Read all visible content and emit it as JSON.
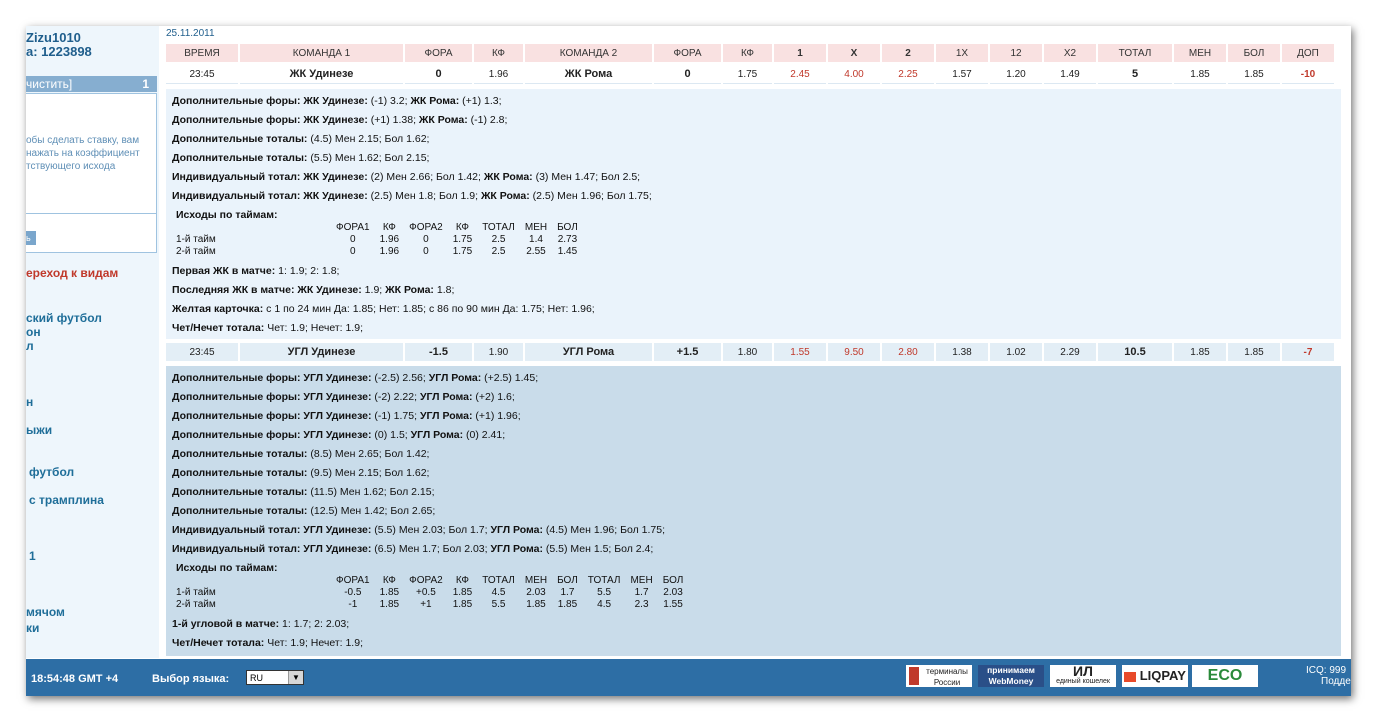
{
  "sidebar": {
    "username": "Zizu1010",
    "account": "а: 1223898",
    "clear_label": "чистить]",
    "bet_count": "1",
    "hint_lines": [
      "обы сделать ставку, вам",
      "нажать на коэффициент",
      "тствующего исхода"
    ],
    "small_button": "ь",
    "nav_red": "ереход к видам",
    "nav_items": [
      "ский футбол",
      "он",
      "л",
      "",
      "ыжи",
      "футбол",
      "с трамплина",
      "1",
      "мячом",
      "ки"
    ]
  },
  "date": "25.11.2011",
  "headers": [
    "ВРЕМЯ",
    "КОМАНДА 1",
    "ФОРА",
    "КФ",
    "КОМАНДА 2",
    "ФОРА",
    "КФ",
    "1",
    "X",
    "2",
    "1X",
    "12",
    "X2",
    "ТОТАЛ",
    "МЕН",
    "БОЛ",
    "ДОП"
  ],
  "match1": {
    "row": [
      "23:45",
      "ЖК Удинезе",
      "0",
      "1.96",
      "ЖК Рома",
      "0",
      "1.75",
      "2.45",
      "4.00",
      "2.25",
      "1.57",
      "1.20",
      "1.49",
      "5",
      "1.85",
      "1.85",
      "-10"
    ],
    "lines": [
      [
        [
          "b",
          "Дополнительные форы: ЖК Удинезе:"
        ],
        [
          "t",
          " (-1) 3.2; "
        ],
        [
          "b",
          "ЖК Рома:"
        ],
        [
          "t",
          " (+1) 1.3;"
        ]
      ],
      [
        [
          "b",
          "Дополнительные форы: ЖК Удинезе:"
        ],
        [
          "t",
          " (+1) 1.38; "
        ],
        [
          "b",
          "ЖК Рома:"
        ],
        [
          "t",
          " (-1) 2.8;"
        ]
      ],
      [
        [
          "b",
          "Дополнительные тоталы:"
        ],
        [
          "t",
          " (4.5) Мен 2.15; Бол 1.62;"
        ]
      ],
      [
        [
          "b",
          "Дополнительные тоталы:"
        ],
        [
          "t",
          " (5.5) Мен 1.62; Бол 2.15;"
        ]
      ],
      [
        [
          "b",
          "Индивидуальный тотал: ЖК Удинезе:"
        ],
        [
          "t",
          " (2) Мен 2.66; Бол 1.42; "
        ],
        [
          "b",
          "ЖК Рома:"
        ],
        [
          "t",
          " (3) Мен 1.47; Бол 2.5;"
        ]
      ],
      [
        [
          "b",
          "Индивидуальный тотал: ЖК Удинезе:"
        ],
        [
          "t",
          " (2.5) Мен 1.8; Бол 1.9; "
        ],
        [
          "b",
          "ЖК Рома:"
        ],
        [
          "t",
          " (2.5) Мен 1.96; Бол 1.75;"
        ]
      ]
    ],
    "periods_title": "Исходы по таймам:",
    "periods_headers": [
      "",
      "ФОРА1",
      "КФ",
      "ФОРА2",
      "КФ",
      "ТОТАЛ",
      "МЕН",
      "БОЛ"
    ],
    "periods_rows": [
      [
        "1-й тайм",
        "0",
        "1.96",
        "0",
        "1.75",
        "2.5",
        "1.4",
        "2.73"
      ],
      [
        "2-й тайм",
        "0",
        "1.96",
        "0",
        "1.75",
        "2.5",
        "2.55",
        "1.45"
      ]
    ],
    "lines_after": [
      [
        [
          "b",
          "Первая ЖК в матче:"
        ],
        [
          "t",
          " 1: 1.9; 2: 1.8;"
        ]
      ],
      [
        [
          "b",
          "Последняя ЖК в матче: ЖК Удинезе:"
        ],
        [
          "t",
          " 1.9; "
        ],
        [
          "b",
          "ЖК Рома:"
        ],
        [
          "t",
          " 1.8;"
        ]
      ],
      [
        [
          "b",
          "Желтая карточка:"
        ],
        [
          "t",
          " с 1 по 24 мин Да: 1.85; Нет: 1.85; с 86 по 90 мин Да: 1.75; Нет: 1.96;"
        ]
      ],
      [
        [
          "b",
          "Чет/Нечет тотала:"
        ],
        [
          "t",
          " Чет: 1.9; Нечет: 1.9;"
        ]
      ]
    ]
  },
  "match2": {
    "row": [
      "23:45",
      "УГЛ Удинезе",
      "-1.5",
      "1.90",
      "УГЛ Рома",
      "+1.5",
      "1.80",
      "1.55",
      "9.50",
      "2.80",
      "1.38",
      "1.02",
      "2.29",
      "10.5",
      "1.85",
      "1.85",
      "-7"
    ],
    "lines": [
      [
        [
          "b",
          "Дополнительные форы: УГЛ Удинезе:"
        ],
        [
          "t",
          " (-2.5) 2.56; "
        ],
        [
          "b",
          "УГЛ Рома:"
        ],
        [
          "t",
          " (+2.5) 1.45;"
        ]
      ],
      [
        [
          "b",
          "Дополнительные форы: УГЛ Удинезе:"
        ],
        [
          "t",
          " (-2) 2.22; "
        ],
        [
          "b",
          "УГЛ Рома:"
        ],
        [
          "t",
          " (+2) 1.6;"
        ]
      ],
      [
        [
          "b",
          "Дополнительные форы: УГЛ Удинезе:"
        ],
        [
          "t",
          " (-1) 1.75; "
        ],
        [
          "b",
          "УГЛ Рома:"
        ],
        [
          "t",
          " (+1) 1.96;"
        ]
      ],
      [
        [
          "b",
          "Дополнительные форы: УГЛ Удинезе:"
        ],
        [
          "t",
          " (0) 1.5; "
        ],
        [
          "b",
          "УГЛ Рома:"
        ],
        [
          "t",
          " (0) 2.41;"
        ]
      ],
      [
        [
          "b",
          "Дополнительные тоталы:"
        ],
        [
          "t",
          " (8.5) Мен 2.65; Бол 1.42;"
        ]
      ],
      [
        [
          "b",
          "Дополнительные тоталы:"
        ],
        [
          "t",
          " (9.5) Мен 2.15; Бол 1.62;"
        ]
      ],
      [
        [
          "b",
          "Дополнительные тоталы:"
        ],
        [
          "t",
          " (11.5) Мен 1.62; Бол 2.15;"
        ]
      ],
      [
        [
          "b",
          "Дополнительные тоталы:"
        ],
        [
          "t",
          " (12.5) Мен 1.42; Бол 2.65;"
        ]
      ],
      [
        [
          "b",
          "Индивидуальный тотал: УГЛ Удинезе:"
        ],
        [
          "t",
          " (5.5) Мен 2.03; Бол 1.7; "
        ],
        [
          "b",
          "УГЛ Рома:"
        ],
        [
          "t",
          " (4.5) Мен 1.96; Бол 1.75;"
        ]
      ],
      [
        [
          "b",
          "Индивидуальный тотал: УГЛ Удинезе:"
        ],
        [
          "t",
          " (6.5) Мен 1.7; Бол 2.03; "
        ],
        [
          "b",
          "УГЛ Рома:"
        ],
        [
          "t",
          " (5.5) Мен 1.5; Бол 2.4;"
        ]
      ]
    ],
    "periods_title": "Исходы по таймам:",
    "periods_headers": [
      "",
      "ФОРА1",
      "КФ",
      "ФОРА2",
      "КФ",
      "ТОТАЛ",
      "МЕН",
      "БОЛ",
      "ТОТАЛ",
      "МЕН",
      "БОЛ"
    ],
    "periods_rows": [
      [
        "1-й тайм",
        "-0.5",
        "1.85",
        "+0.5",
        "1.85",
        "4.5",
        "2.03",
        "1.7",
        "5.5",
        "1.7",
        "2.03"
      ],
      [
        "2-й тайм",
        "-1",
        "1.85",
        "+1",
        "1.85",
        "5.5",
        "1.85",
        "1.85",
        "4.5",
        "2.3",
        "1.55"
      ]
    ],
    "lines_after": [
      [
        [
          "b",
          "1-й угловой в матче:"
        ],
        [
          "t",
          " 1: 1.7; 2: 2.03;"
        ]
      ],
      [
        [
          "b",
          "Чет/Нечет тотала:"
        ],
        [
          "t",
          " Чет: 1.9; Нечет: 1.9;"
        ]
      ]
    ]
  },
  "footer": {
    "clock": "18:54:48  GMT +4",
    "lang_label": "Выбор языка:",
    "lang_value": "RU",
    "logos": [
      "терминалы России",
      "принимаем WebMoney",
      "единый кошелек",
      "LIQPAY",
      "ECO"
    ],
    "icq": "ICQ: 999",
    "support": "Подде"
  },
  "colors": {
    "footer_bg": "#2d6ea5",
    "header_bg": "#f9e1e1",
    "odds_red": "#c0392b",
    "link_blue": "#1f6e99"
  }
}
